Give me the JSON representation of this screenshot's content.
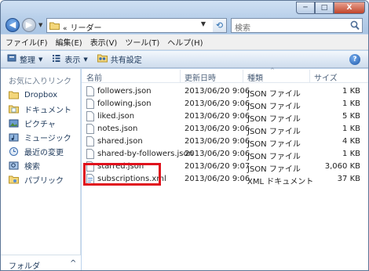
{
  "window": {
    "address_crumb_prefix": "«",
    "address_folder": "リーダー",
    "search_placeholder": "検索",
    "caption": {
      "minimize": "─",
      "maximize": "□",
      "close": "X"
    }
  },
  "menu": [
    "ファイル(F)",
    "編集(E)",
    "表示(V)",
    "ツール(T)",
    "ヘルプ(H)"
  ],
  "commands": {
    "organize": "整理",
    "view": "表示",
    "share": "共有設定"
  },
  "nav": {
    "heading": "お気に入りリンク",
    "items": [
      {
        "label": "Dropbox",
        "icon": "dropbox-folder-icon"
      },
      {
        "label": "ドキュメント",
        "icon": "documents-icon"
      },
      {
        "label": "ピクチャ",
        "icon": "pictures-icon"
      },
      {
        "label": "ミュージック",
        "icon": "music-icon"
      },
      {
        "label": "最近の変更",
        "icon": "recent-icon"
      },
      {
        "label": "検索",
        "icon": "search-folder-icon"
      },
      {
        "label": "パブリック",
        "icon": "public-folder-icon"
      }
    ],
    "footer_label": "フォルダ",
    "footer_chevron": "^"
  },
  "columns": {
    "name": "名前",
    "date": "更新日時",
    "type": "種類",
    "size": "サイズ"
  },
  "files": [
    {
      "name": "followers.json",
      "date": "2013/06/20 9:06",
      "type": "JSON ファイル",
      "size": "1 KB"
    },
    {
      "name": "following.json",
      "date": "2013/06/20 9:06",
      "type": "JSON ファイル",
      "size": "1 KB"
    },
    {
      "name": "liked.json",
      "date": "2013/06/20 9:06",
      "type": "JSON ファイル",
      "size": "5 KB"
    },
    {
      "name": "notes.json",
      "date": "2013/06/20 9:06",
      "type": "JSON ファイル",
      "size": "1 KB"
    },
    {
      "name": "shared.json",
      "date": "2013/06/20 9:06",
      "type": "JSON ファイル",
      "size": "4 KB"
    },
    {
      "name": "shared-by-followers.json",
      "date": "2013/06/20 9:06",
      "type": "JSON ファイル",
      "size": "1 KB"
    },
    {
      "name": "starred.json",
      "date": "2013/06/20 9:07",
      "type": "JSON ファイル",
      "size": "3,060 KB"
    },
    {
      "name": "subscriptions.xml",
      "date": "2013/06/20 9:06",
      "type": "XML ドキュメント",
      "size": "37 KB"
    }
  ],
  "highlight_color": "#e0101c"
}
